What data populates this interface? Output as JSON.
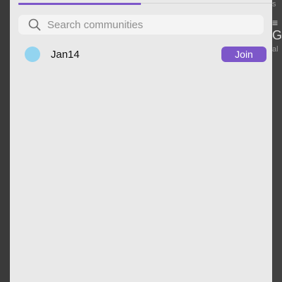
{
  "colors": {
    "accent": "#7d57c9",
    "avatar": "#93d4f0"
  },
  "tabs": {
    "active_index": 0
  },
  "search": {
    "placeholder": "Search communities",
    "value": "",
    "icon": "search-icon"
  },
  "communities": [
    {
      "name": "Jan14",
      "join_label": "Join"
    }
  ],
  "background_app": {
    "fragments": [
      "s",
      "≡",
      "Gl",
      "al"
    ]
  }
}
